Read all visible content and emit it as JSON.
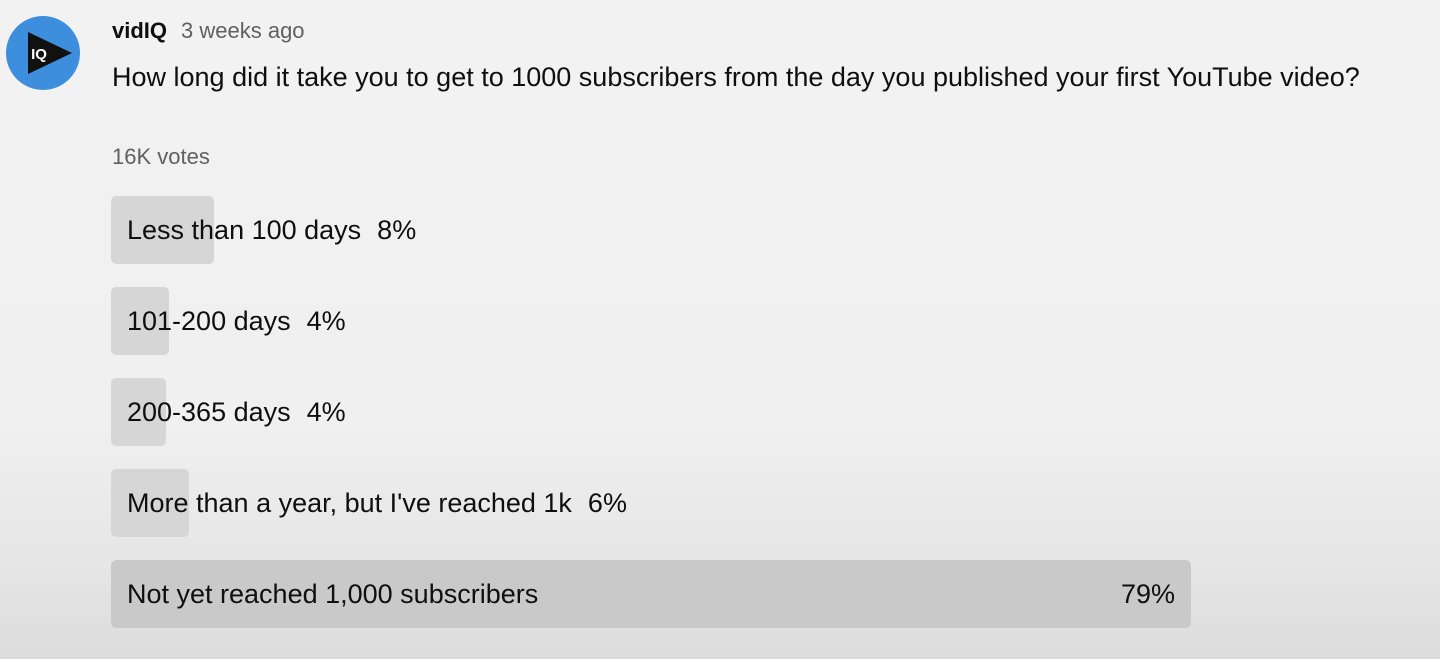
{
  "post": {
    "channel": "vidIQ",
    "timestamp": "3 weeks ago",
    "avatar_icon": "vidiq-logo-icon",
    "avatar_text": "IQ",
    "question": "How long did it take you to get to 1000 subscribers from the day you published your first YouTube video?",
    "votes": "16K votes"
  },
  "poll": {
    "options": [
      {
        "label": "Less than 100 days",
        "percent_text": "8%",
        "fill_fraction": 0.095
      },
      {
        "label": "101-200 days",
        "percent_text": "4%",
        "fill_fraction": 0.054
      },
      {
        "label": "200-365 days",
        "percent_text": "4%",
        "fill_fraction": 0.051
      },
      {
        "label": "More than a year, but I've reached 1k",
        "percent_text": "6%",
        "fill_fraction": 0.072
      },
      {
        "label": "Not yet reached 1,000 subscribers",
        "percent_text": "79%",
        "fill_fraction": 1.0
      }
    ]
  },
  "colors": {
    "avatar_bg": "#3d8fde",
    "bar_fill": "#d6d6d6",
    "leading_bar_fill": "#c9c9c9",
    "secondary_text": "#606060"
  }
}
